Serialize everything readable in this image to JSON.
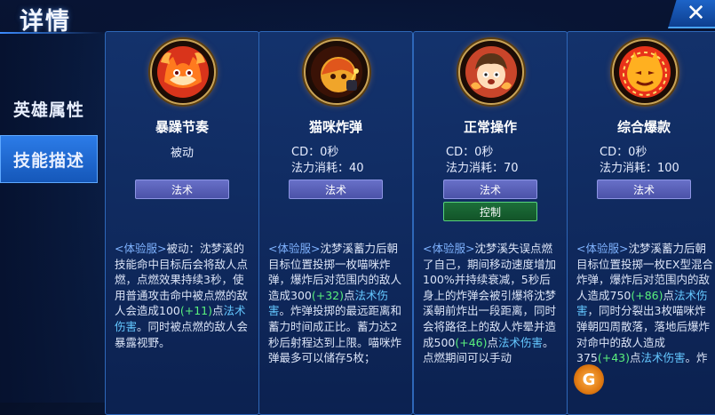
{
  "header": {
    "title": "详情",
    "close_label": "✕"
  },
  "sidebar": {
    "tabs": [
      {
        "label": "英雄属性"
      },
      {
        "label": "技能描述"
      }
    ]
  },
  "colors": {
    "magic_badge": "#5a62b8",
    "control_badge": "#1c6e3a",
    "active_tab": "#2c7ce8",
    "highlight_number": "#59f07d",
    "damage_text": "#64c7ff"
  },
  "skills": [
    {
      "name": "暴躁节奏",
      "icon": "angry-cat-flame-icon",
      "passive": "被动",
      "cd": "",
      "mana": "",
      "badges": [
        "法术"
      ],
      "desc": [
        {
          "t": "tag",
          "v": "<体验服>"
        },
        {
          "t": "text",
          "v": "被动：沈梦溪的技能命中目标后会将敌人点燃，点燃效果持续3秒，使用普通攻击命中被点燃的敌人会造成100"
        },
        {
          "t": "num",
          "v": "(+11)"
        },
        {
          "t": "text",
          "v": "点"
        },
        {
          "t": "dmg",
          "v": "法术伤害"
        },
        {
          "t": "text",
          "v": "。同时被点燃的敌人会暴露视野。"
        }
      ]
    },
    {
      "name": "猫咪炸弹",
      "icon": "cat-bomb-icon",
      "passive": "",
      "cd": "CD：0秒",
      "mana": "法力消耗：40",
      "badges": [
        "法术"
      ],
      "desc": [
        {
          "t": "tag",
          "v": "<体验服>"
        },
        {
          "t": "text",
          "v": "沈梦溪蓄力后朝目标位置投掷一枚喵咪炸弹，爆炸后对范围内的敌人造成300"
        },
        {
          "t": "num",
          "v": "(+32)"
        },
        {
          "t": "text",
          "v": "点"
        },
        {
          "t": "dmg",
          "v": "法术伤害"
        },
        {
          "t": "text",
          "v": "。炸弹投掷的最远距离和蓄力时间成正比。蓄力达2秒后射程达到上限。喵咪炸弹最多可以储存5枚；"
        }
      ]
    },
    {
      "name": "正常操作",
      "icon": "surprised-hero-icon",
      "passive": "",
      "cd": "CD：0秒",
      "mana": "法力消耗：70",
      "badges": [
        "法术",
        "控制"
      ],
      "desc": [
        {
          "t": "tag",
          "v": "<体验服>"
        },
        {
          "t": "text",
          "v": "沈梦溪失误点燃了自己，期间移动速度增加100%并持续衰减，5秒后身上的炸弹会被引爆将沈梦溪朝前炸出一段距离，同时会将路径上的敌人炸晕并造成500"
        },
        {
          "t": "num",
          "v": "(+46)"
        },
        {
          "t": "text",
          "v": "点"
        },
        {
          "t": "dmg",
          "v": "法术伤害"
        },
        {
          "t": "text",
          "v": "。点燃期间可以手动"
        }
      ]
    },
    {
      "name": "综合爆款",
      "icon": "exploding-cat-icon",
      "passive": "",
      "cd": "CD：0秒",
      "mana": "法力消耗：100",
      "badges": [
        "法术"
      ],
      "desc": [
        {
          "t": "tag",
          "v": "<体验服>"
        },
        {
          "t": "text",
          "v": "沈梦溪蓄力后朝目标位置投掷一枚EX型混合炸弹，爆炸后对范围内的敌人造成750"
        },
        {
          "t": "num",
          "v": "(+86)"
        },
        {
          "t": "text",
          "v": "点"
        },
        {
          "t": "dmg",
          "v": "法术伤害"
        },
        {
          "t": "text",
          "v": "，同时分裂出3枚喵咪炸弹朝四周散落，落地后爆炸对命中的敌人造成375"
        },
        {
          "t": "num",
          "v": "(+43)"
        },
        {
          "t": "text",
          "v": "点"
        },
        {
          "t": "dmg",
          "v": "法术伤害"
        },
        {
          "t": "text",
          "v": "。炸"
        }
      ]
    }
  ]
}
